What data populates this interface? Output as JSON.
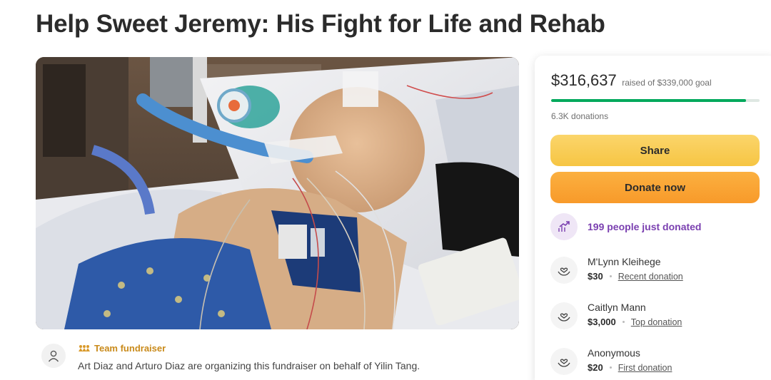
{
  "page": {
    "title": "Help Sweet Jeremy: His Fight for Life and Rehab"
  },
  "hero": {
    "alt": "Child in hospital bed with breathing tube and monitors"
  },
  "organizer": {
    "tag": "Team fundraiser",
    "text": "Art Diaz and Arturo Diaz are organizing this fundraiser on behalf of Yilin Tang."
  },
  "donation_card": {
    "raised": "$316,637",
    "goal_text": "raised of $339,000 goal",
    "progress_fraction": 0.934,
    "donations_count": "6.3K donations",
    "share_label": "Share",
    "donate_label": "Donate now",
    "just_donated": "199 people just donated",
    "donors": [
      {
        "name": "M'Lynn Kleihege",
        "amount": "$30",
        "tag": "Recent donation"
      },
      {
        "name": "Caitlyn Mann",
        "amount": "$3,000",
        "tag": "Top donation"
      },
      {
        "name": "Anonymous",
        "amount": "$20",
        "tag": "First donation"
      }
    ]
  },
  "colors": {
    "progress": "#02a95c",
    "share": "#f6c543",
    "donate": "#f89a2a",
    "accent_purple": "#7a3fb0",
    "team_tag": "#c98a1a"
  },
  "icons": {
    "organizer": "user-icon",
    "team": "team-icon",
    "trend": "trend-up-icon",
    "donor": "heart-hands-icon"
  }
}
